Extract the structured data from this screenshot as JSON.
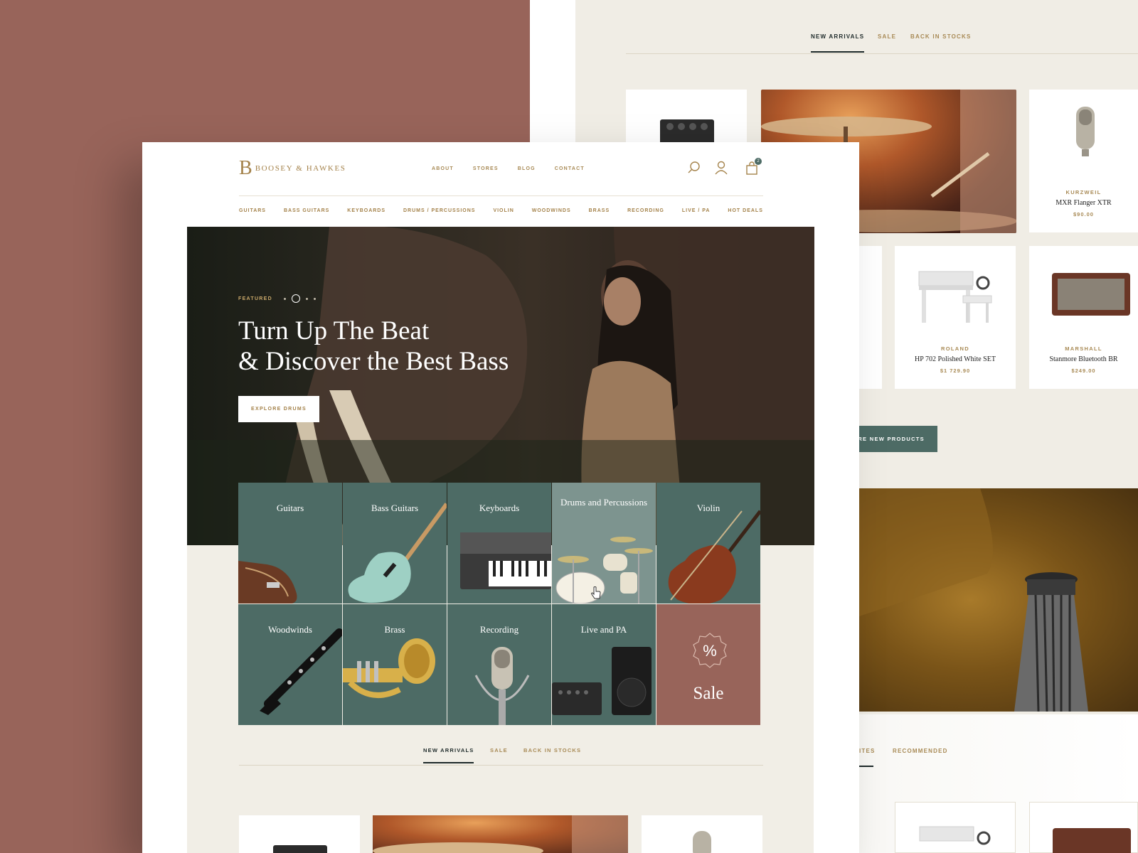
{
  "back_page": {
    "tabs": [
      {
        "label": "NEW ARRIVALS",
        "active": true
      },
      {
        "label": "SALE",
        "active": false
      },
      {
        "label": "BACK IN STOCKS",
        "active": false
      }
    ],
    "products": [
      {
        "brand": "KURZWEIL",
        "name": "MXR Flanger XTR",
        "price": "$90.00"
      },
      {
        "brand": "ROLAND",
        "name": "HP 702 Polished White SET",
        "price": "$1 729.90"
      },
      {
        "brand": "MARSHALL",
        "name": "Stanmore Bluetooth BR",
        "price": "$249.00"
      }
    ],
    "more_button": "ORE NEW PRODUCTS",
    "bottom_tabs": [
      {
        "label": "ITES",
        "active": true
      },
      {
        "label": "RECOMMENDED",
        "active": false
      }
    ]
  },
  "header": {
    "logo_mark": "B",
    "logo_text": "BOOSEY & HAWKES",
    "top_nav": [
      "ABOUT",
      "STORES",
      "BLOG",
      "CONTACT"
    ],
    "cart_count": "2"
  },
  "category_nav": [
    "GUITARS",
    "BASS GUITARS",
    "KEYBOARDS",
    "DRUMS / PERCUSSIONS",
    "VIOLIN",
    "WOODWINDS",
    "BRASS",
    "RECORDING",
    "LIVE / PA",
    "HOT DEALS"
  ],
  "hero": {
    "eyebrow": "FEATURED",
    "title_line1": "Turn Up The Beat",
    "title_line2": "& Discover the Best Bass",
    "button": "EXPLORE DRUMS"
  },
  "tiles": [
    {
      "label": "Guitars"
    },
    {
      "label": "Bass Guitars"
    },
    {
      "label": "Keyboards"
    },
    {
      "label": "Drums and Percussions"
    },
    {
      "label": "Violin"
    },
    {
      "label": "Woodwinds"
    },
    {
      "label": "Brass"
    },
    {
      "label": "Recording"
    },
    {
      "label": "Live and PA"
    },
    {
      "label": "Sale",
      "icon": "%"
    }
  ],
  "front_tabs": [
    {
      "label": "NEW ARRIVALS",
      "active": true
    },
    {
      "label": "SALE",
      "active": false
    },
    {
      "label": "BACK IN STOCKS",
      "active": false
    }
  ],
  "colors": {
    "accent_green": "#4d6b65",
    "accent_brown": "#98645a",
    "gold": "#a4824a",
    "beige": "#f1eee6"
  }
}
